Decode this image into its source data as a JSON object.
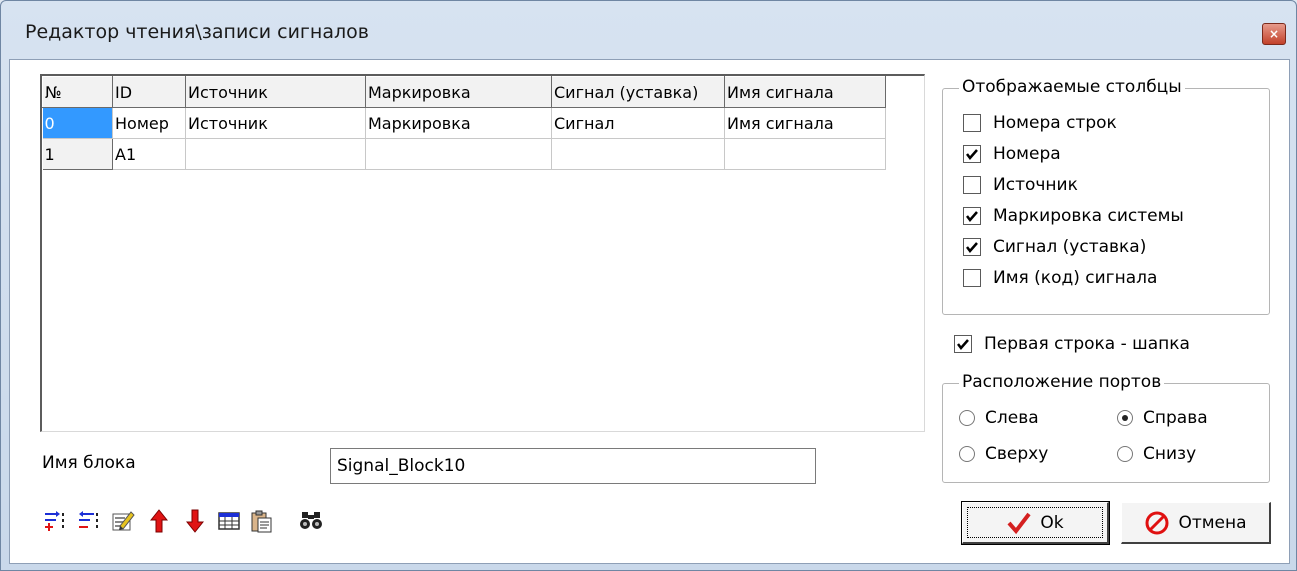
{
  "window": {
    "title": "Редактор чтения\\записи сигналов",
    "close_glyph": "×"
  },
  "grid": {
    "columns": [
      "№",
      "ID",
      "Источник",
      "Маркировка",
      "Сигнал (уставка)",
      "Имя сигнала"
    ],
    "rows": [
      [
        "0",
        "Номер",
        "Источник",
        "Маркировка",
        "Сигнал",
        "Имя сигнала"
      ],
      [
        "1",
        "A1",
        "",
        "",
        "",
        ""
      ]
    ],
    "selected_cell": "0"
  },
  "block": {
    "label": "Имя блока",
    "value": "Signal_Block10"
  },
  "toolbar": {
    "icons": [
      "add-row-icon",
      "delete-row-icon",
      "edit-icon",
      "move-up-icon",
      "move-down-icon",
      "table-icon",
      "paste-icon",
      "find-icon"
    ]
  },
  "columns_group": {
    "title": "Отображаемые столбцы",
    "items": [
      {
        "label": "Номера строк",
        "checked": false
      },
      {
        "label": "Номера",
        "checked": true
      },
      {
        "label": "Источник",
        "checked": false
      },
      {
        "label": "Маркировка системы",
        "checked": true
      },
      {
        "label": "Сигнал (уставка)",
        "checked": true
      },
      {
        "label": "Имя (код) сигнала",
        "checked": false
      }
    ]
  },
  "first_row_header": {
    "label": "Первая строка - шапка",
    "checked": true
  },
  "ports_group": {
    "title": "Расположение портов",
    "options": [
      {
        "label": "Слева",
        "selected": false
      },
      {
        "label": "Справа",
        "selected": true
      },
      {
        "label": "Сверху",
        "selected": false
      },
      {
        "label": "Снизу",
        "selected": false
      }
    ]
  },
  "buttons": {
    "ok_label": "Ok",
    "cancel_label": "Отмена"
  },
  "colors": {
    "selection": "#3399ff",
    "check": "#000000",
    "ok_check": "#d42020",
    "cancel_icon": "#e01010"
  }
}
